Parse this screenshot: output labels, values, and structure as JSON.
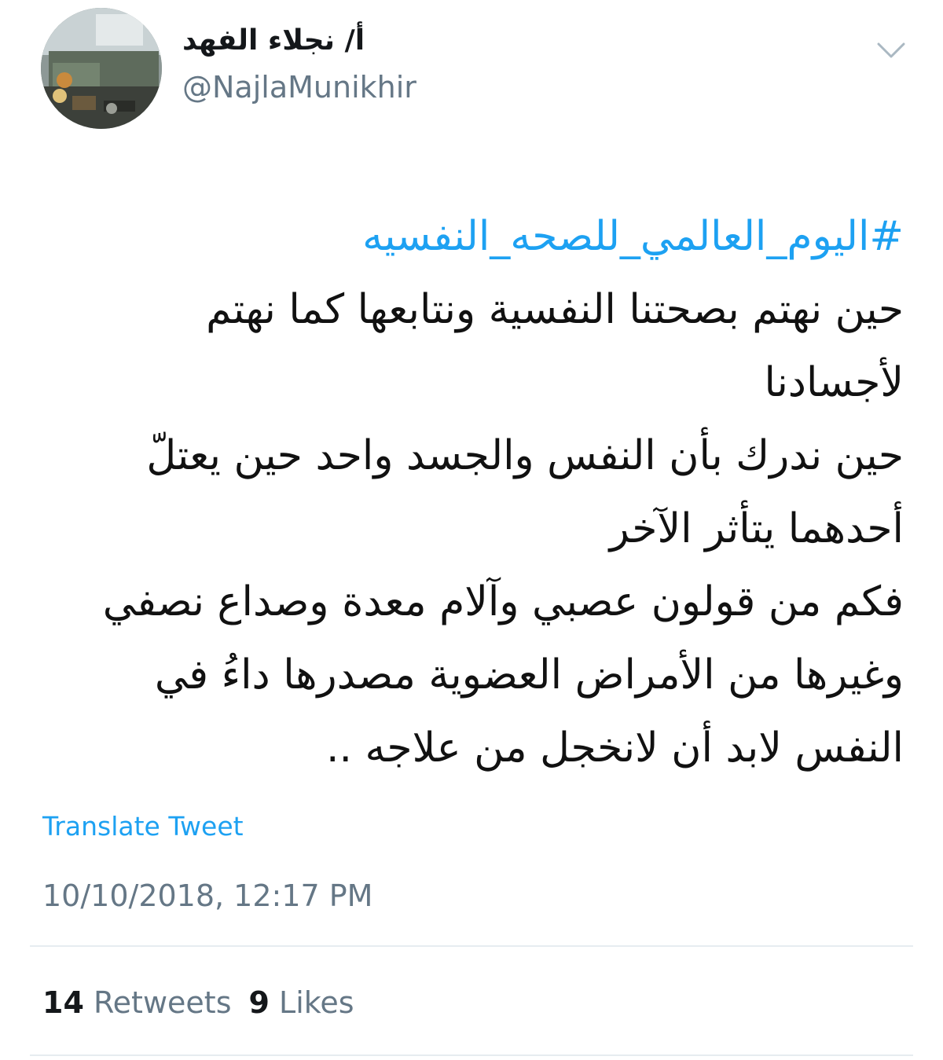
{
  "user": {
    "display_name": "أ/ نجلاء الفهد",
    "handle": "@NajlaMunikhir",
    "avatar_icon": "profile-photo"
  },
  "tweet": {
    "hashtag": "#اليوم_العالمي_للصحه_النفسيه",
    "lines": [
      "حين نهتم بصحتنا النفسية ونتابعها كما نهتم",
      "لأجسادنا",
      "حين ندرك بأن النفس والجسد واحد حين يعتلّ",
      "أحدهما يتأثر الآخر",
      "فكم من قولون عصبي وآلام معدة وصداع نصفي",
      "وغيرها من الأمراض العضوية مصدرها داءُ في",
      "النفس لابد أن لانخجل من علاجه .."
    ]
  },
  "actions": {
    "translate_label": "Translate Tweet",
    "menu_icon": "chevron-down-icon"
  },
  "timestamp": "10/10/2018, 12:17 PM",
  "stats": {
    "retweets_count": "14",
    "retweets_label": "Retweets",
    "likes_count": "9",
    "likes_label": "Likes"
  },
  "colors": {
    "link": "#1da1f2",
    "secondary_text": "#657786",
    "primary_text": "#14171a",
    "divider": "#e6ecf0"
  }
}
